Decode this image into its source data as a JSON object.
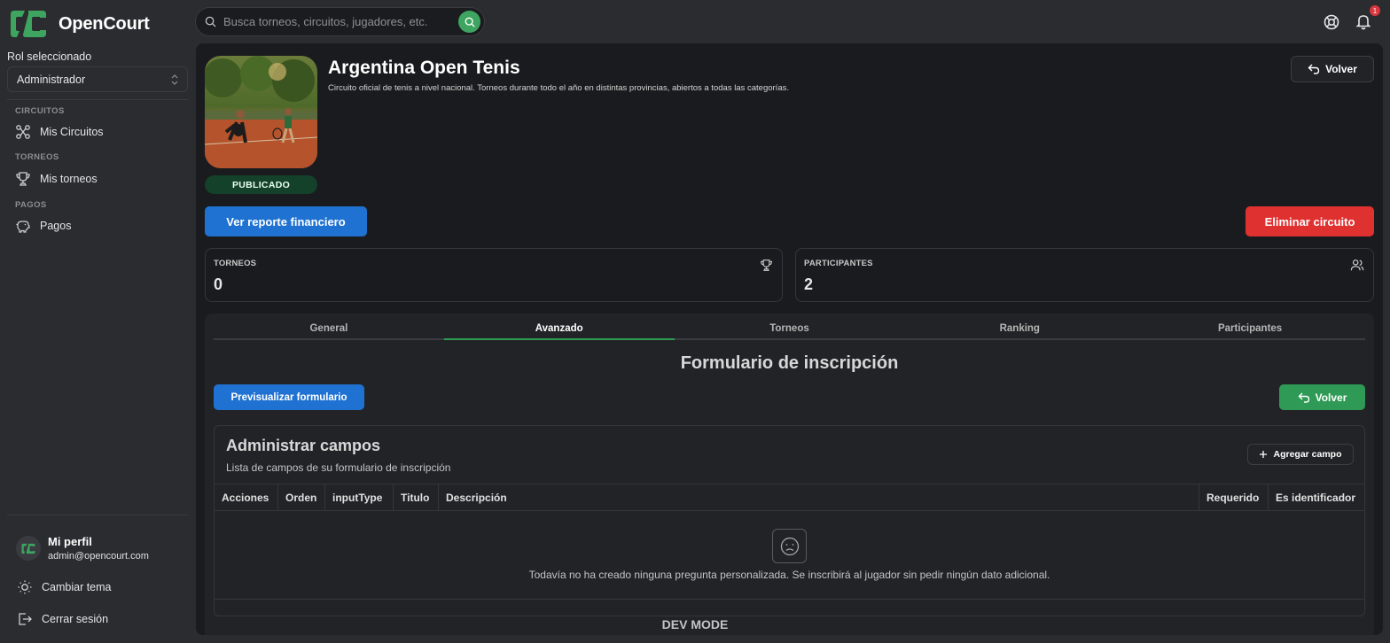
{
  "app": {
    "name": "OpenCourt"
  },
  "sidebar": {
    "role_label": "Rol seleccionado",
    "role_value": "Administrador",
    "sections": [
      {
        "label": "CIRCUITOS",
        "item": "Mis Circuitos",
        "icon": "circuit-icon"
      },
      {
        "label": "TORNEOS",
        "item": "Mis torneos",
        "icon": "trophy-icon"
      },
      {
        "label": "PAGOS",
        "item": "Pagos",
        "icon": "piggy-bank-icon"
      }
    ],
    "profile": {
      "name": "Mi perfil",
      "email": "admin@opencourt.com"
    },
    "theme_label": "Cambiar tema",
    "logout_label": "Cerrar sesión"
  },
  "topbar": {
    "search_placeholder": "Busca torneos, circuitos, jugadores, etc.",
    "notification_count": "1"
  },
  "circuit": {
    "title": "Argentina Open Tenis",
    "description": "Circuito oficial de tenis a nivel nacional. Torneos durante todo el año en distintas provincias, abiertos a todas las categorías.",
    "status": "PUBLICADO",
    "back_label": "Volver",
    "report_label": "Ver reporte financiero",
    "delete_label": "Eliminar circuito"
  },
  "stats": [
    {
      "label": "TORNEOS",
      "value": "0",
      "icon": "trophy-icon"
    },
    {
      "label": "PARTICIPANTES",
      "value": "2",
      "icon": "users-icon"
    }
  ],
  "tabs": [
    "General",
    "Avanzado",
    "Torneos",
    "Ranking",
    "Participantes"
  ],
  "active_tab": "Avanzado",
  "form": {
    "title": "Formulario de inscripción",
    "preview_label": "Previsualizar formulario",
    "back_label": "Volver",
    "fields_title": "Administrar campos",
    "fields_subtitle": "Lista de campos de su formulario de inscripción",
    "add_field_label": "Agregar campo",
    "columns": [
      "Acciones",
      "Orden",
      "inputType",
      "Titulo",
      "Descripción",
      "Requerido",
      "Es identificador"
    ],
    "empty_message": "Todavía no ha creado ninguna pregunta personalizada. Se inscribirá al jugador sin pedir ningún dato adicional."
  },
  "footer": {
    "dev_mode": "DEV MODE"
  },
  "colors": {
    "accent_green": "#2f9a55",
    "primary_blue": "#1f72d1",
    "danger_red": "#e03131",
    "background": "#2b2c30",
    "panel": "#1a1b1e"
  }
}
